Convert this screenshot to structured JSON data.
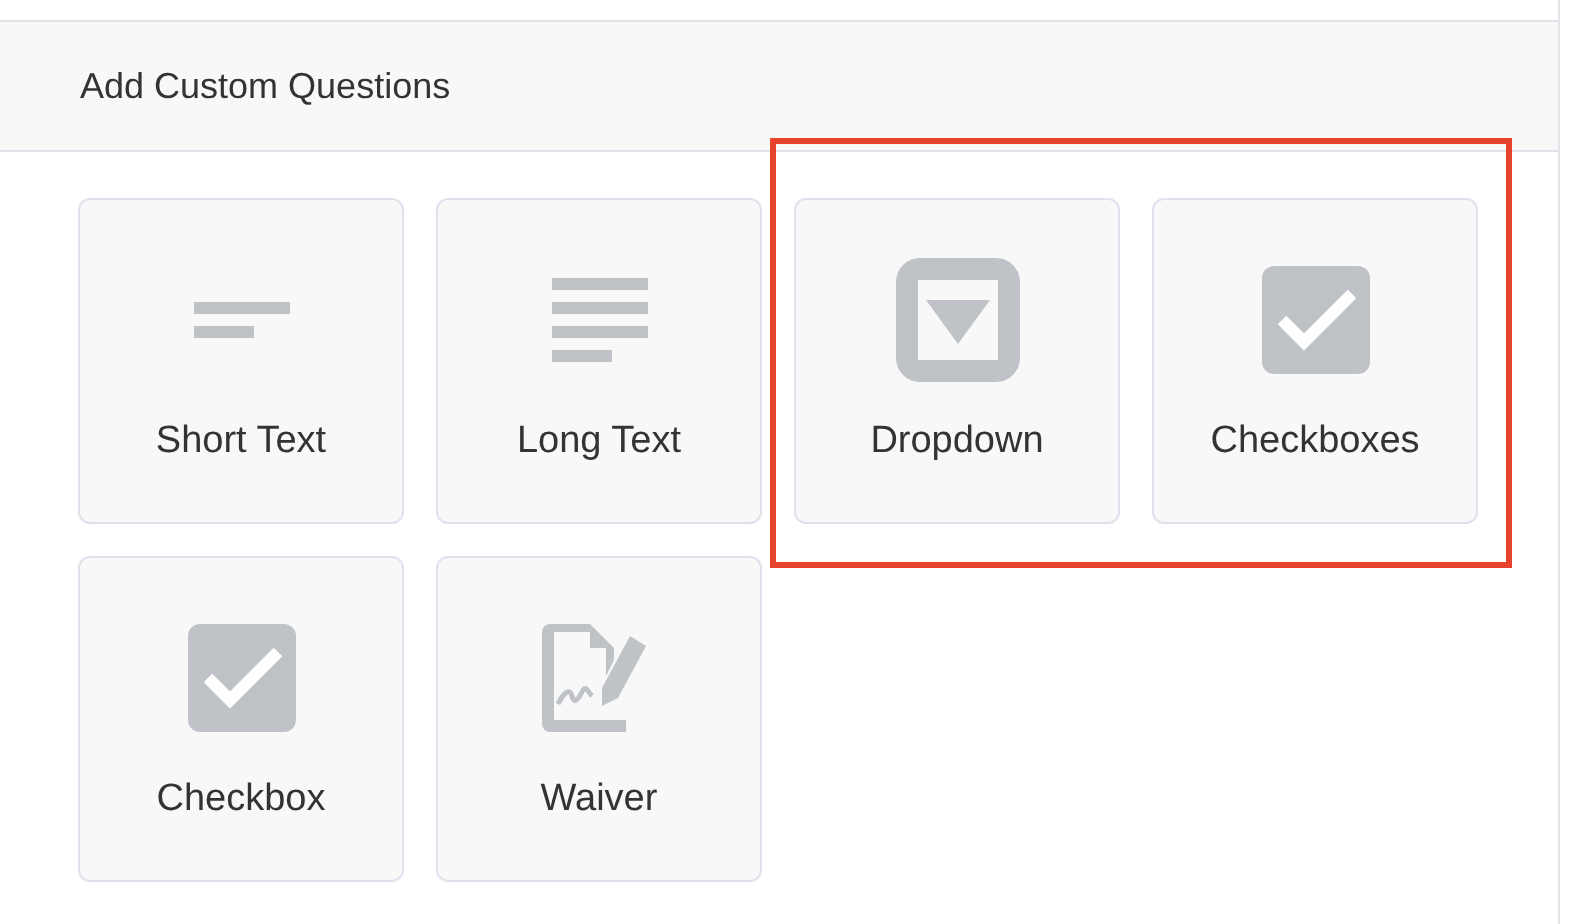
{
  "section": {
    "title": "Add Custom Questions"
  },
  "question_types": [
    {
      "label": "Short Text",
      "kind": "short_text",
      "highlighted": false
    },
    {
      "label": "Long Text",
      "kind": "long_text",
      "highlighted": false
    },
    {
      "label": "Dropdown",
      "kind": "dropdown",
      "highlighted": true
    },
    {
      "label": "Checkboxes",
      "kind": "checkboxes",
      "highlighted": true
    },
    {
      "label": "Checkbox",
      "kind": "checkbox",
      "highlighted": false
    },
    {
      "label": "Waiver",
      "kind": "waiver",
      "highlighted": false
    }
  ]
}
